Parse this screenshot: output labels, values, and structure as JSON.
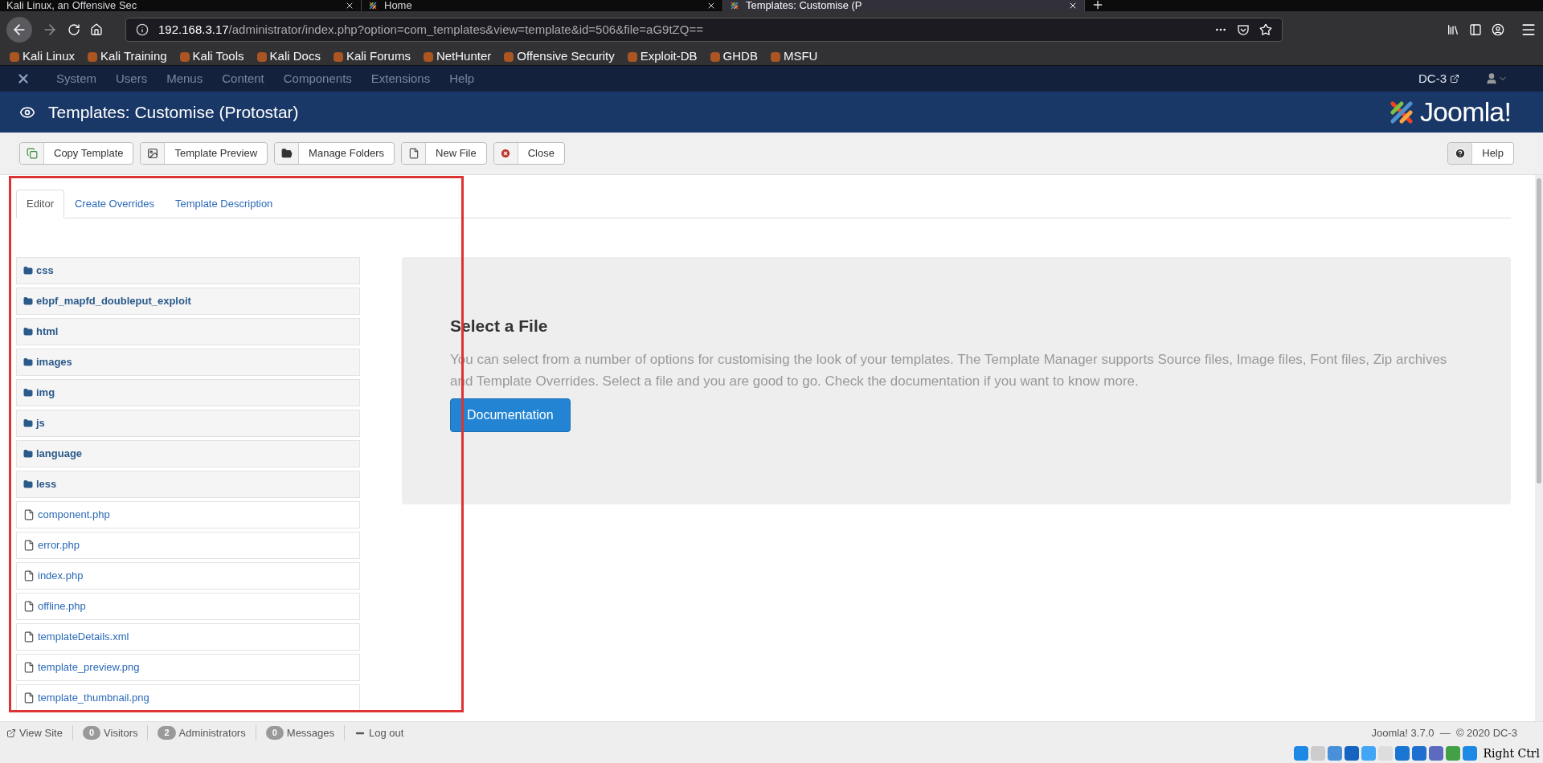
{
  "browser": {
    "tabs": [
      {
        "title": "Kali Linux, an Offensive Sec",
        "selected": false
      },
      {
        "title": "Home",
        "selected": false
      },
      {
        "title": "Templates: Customise (P",
        "selected": true
      }
    ],
    "url": {
      "host": "192.168.3.17",
      "path": "/administrator/index.php?option=com_templates&view=template&id=506&file=aG9tZQ=="
    },
    "bookmarks": [
      "Kali Linux",
      "Kali Training",
      "Kali Tools",
      "Kali Docs",
      "Kali Forums",
      "NetHunter",
      "Offensive Security",
      "Exploit-DB",
      "GHDB",
      "MSFU"
    ]
  },
  "admin_menu": {
    "items": [
      "System",
      "Users",
      "Menus",
      "Content",
      "Components",
      "Extensions",
      "Help"
    ],
    "site": "DC-3"
  },
  "header": {
    "title": "Templates: Customise (Protostar)",
    "logo": "Joomla!"
  },
  "toolbar": {
    "buttons": [
      {
        "label": "Copy Template",
        "kind": "copy"
      },
      {
        "label": "Template Preview",
        "kind": "image"
      },
      {
        "label": "Manage Folders",
        "kind": "folder"
      },
      {
        "label": "New File",
        "kind": "file"
      },
      {
        "label": "Close",
        "kind": "close"
      }
    ],
    "help": "Help"
  },
  "tabs": [
    {
      "label": "Editor",
      "selected": true
    },
    {
      "label": "Create Overrides",
      "selected": false
    },
    {
      "label": "Template Description",
      "selected": false
    }
  ],
  "files": [
    {
      "name": "css",
      "kind": "folder"
    },
    {
      "name": "ebpf_mapfd_doubleput_exploit",
      "kind": "folder"
    },
    {
      "name": "html",
      "kind": "folder"
    },
    {
      "name": "images",
      "kind": "folder"
    },
    {
      "name": "img",
      "kind": "folder"
    },
    {
      "name": "js",
      "kind": "folder"
    },
    {
      "name": "language",
      "kind": "folder"
    },
    {
      "name": "less",
      "kind": "folder"
    },
    {
      "name": "component.php",
      "kind": "file"
    },
    {
      "name": "error.php",
      "kind": "file"
    },
    {
      "name": "index.php",
      "kind": "file"
    },
    {
      "name": "offline.php",
      "kind": "file"
    },
    {
      "name": "templateDetails.xml",
      "kind": "file"
    },
    {
      "name": "template_preview.png",
      "kind": "file"
    },
    {
      "name": "template_thumbnail.png",
      "kind": "file"
    }
  ],
  "panel": {
    "title": "Select a File",
    "text": "You can select from a number of options for customising the look of your templates. The Template Manager supports Source files, Image files, Font files, Zip archives and Template Overrides. Select a file and you are good to go. Check the documentation if you want to know more.",
    "button": "Documentation"
  },
  "status_bar": {
    "view_site": "View Site",
    "counters": [
      {
        "count": "0",
        "label": "Visitors"
      },
      {
        "count": "2",
        "label": "Administrators"
      },
      {
        "count": "0",
        "label": "Messages"
      }
    ],
    "logout": "Log out",
    "version": "Joomla! 3.7.0  —  © 2020 DC-3"
  },
  "vm_bar": {
    "host_key": "Right Ctrl"
  }
}
